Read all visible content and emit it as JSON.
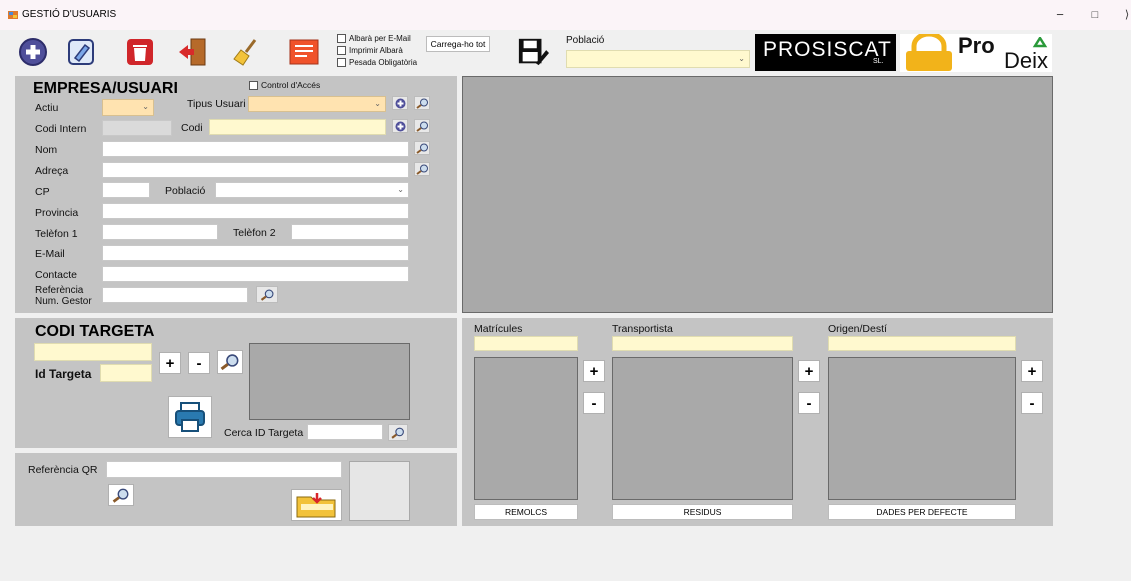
{
  "window": {
    "title": "GESTIÓ D'USUARIS",
    "min": "−",
    "max": "□",
    "close": "⟩"
  },
  "toolbar": {
    "icons": [
      "add-icon",
      "edit-icon",
      "delete-icon",
      "exit-icon",
      "clear-icon",
      "report-icon",
      "save-icon"
    ],
    "checkboxes": [
      "Albarà per E-Mail",
      "Imprimir Albarà",
      "Pesada Obligatòria"
    ],
    "load_all": "Carrega-ho tot",
    "poblacio_label": "Població"
  },
  "logos": {
    "prosiscat": "PROSISCAT",
    "prosiscat_sub": "SL.",
    "prodeix_top": "Pro",
    "prodeix_bottom": "Deix"
  },
  "empresa": {
    "title": "EMPRESA/USUARI",
    "access_control": "Control d'Accés",
    "actiu": "Actiu",
    "tipus_usuari": "Tipus Usuari",
    "codi_intern": "Codi Intern",
    "codi": "Codi",
    "nom": "Nom",
    "adreca": "Adreça",
    "cp": "CP",
    "poblacio": "Població",
    "provincia": "Provincia",
    "telefon1": "Telèfon 1",
    "telefon2": "Telèfon 2",
    "email": "E-Mail",
    "contacte": "Contacte",
    "referencia": "Referència",
    "num_gestor": "Num. Gestor"
  },
  "targeta": {
    "title": "CODI TARGETA",
    "id": "Id Targeta",
    "plus": "+",
    "minus": "-",
    "search_label": "Cerca ID Targeta"
  },
  "qr": {
    "label": "Referència QR"
  },
  "lists": {
    "matricules": "Matrícules",
    "transportista": "Transportista",
    "origen": "Origen/Destí",
    "remolcs": "REMOLCS",
    "residus": "RESIDUS",
    "defecte": "DADES PER DEFECTE",
    "plus": "+",
    "minus": "-"
  }
}
